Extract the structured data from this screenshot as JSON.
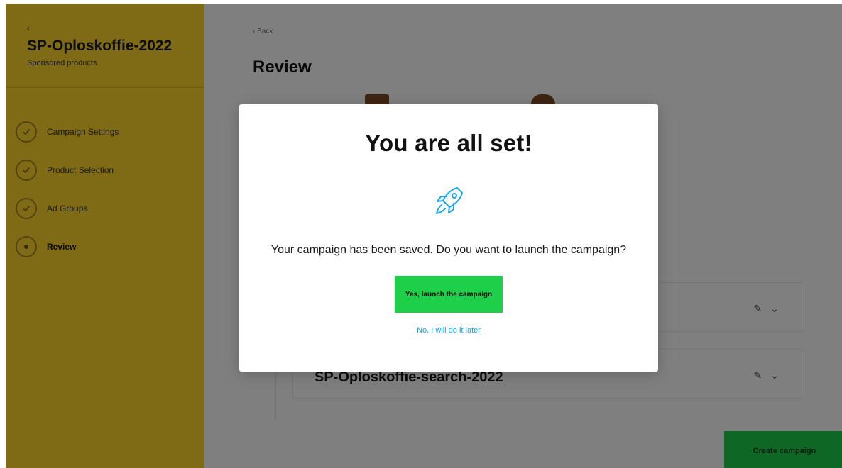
{
  "sidebar": {
    "back_label": "‹",
    "campaign_name": "SP-Oploskoffie-2022",
    "campaign_subtitle": "Sponsored products",
    "steps": [
      {
        "label": "Campaign Settings",
        "state": "done"
      },
      {
        "label": "Product Selection",
        "state": "done"
      },
      {
        "label": "Ad Groups",
        "state": "done"
      },
      {
        "label": "Review",
        "state": "active"
      }
    ]
  },
  "main": {
    "back_link": "‹ Back",
    "page_title": "Review",
    "adgroups": [
      {
        "title": "",
        "edit_icon": "edit-icon",
        "expand_icon": "chevron-down-icon"
      },
      {
        "title": "SP-Oploskoffie-search-2022",
        "edit_icon": "edit-icon",
        "expand_icon": "chevron-down-icon"
      }
    ],
    "create_button_label": "Create campaign"
  },
  "modal": {
    "title": "You are all set!",
    "icon": "rocket-icon",
    "message": "Your campaign has been saved. Do you want to launch the campaign?",
    "confirm_label": "Yes, launch the campaign",
    "cancel_label": "No, I will do it later"
  },
  "colors": {
    "sidebar": "#ffd42a",
    "primary_green": "#1ecf4a",
    "link_blue": "#1a9ed6",
    "rocket_blue": "#1ea6e0",
    "overlay": "rgba(0,0,0,0.5)"
  }
}
